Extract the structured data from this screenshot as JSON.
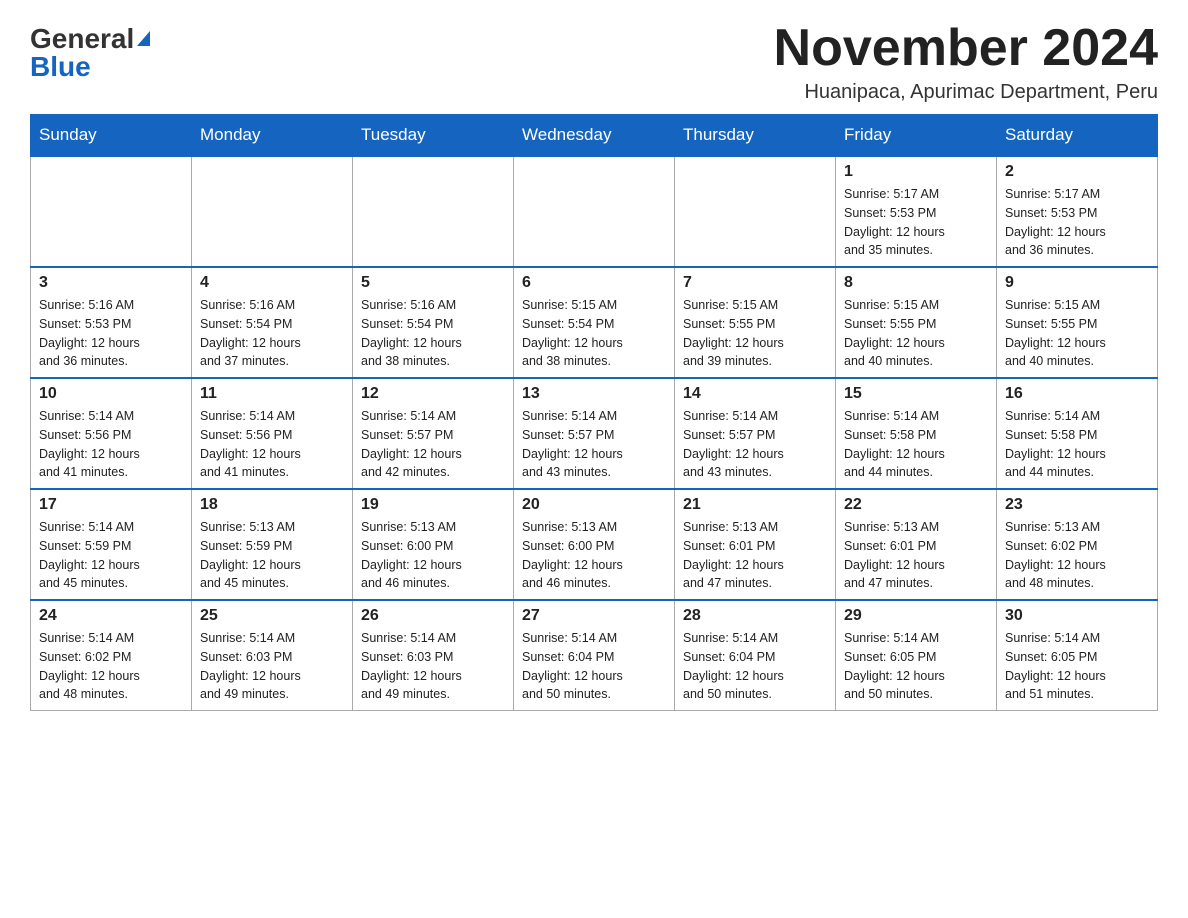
{
  "logo": {
    "general": "General",
    "blue": "Blue"
  },
  "title": {
    "month_year": "November 2024",
    "location": "Huanipaca, Apurimac Department, Peru"
  },
  "days_of_week": [
    "Sunday",
    "Monday",
    "Tuesday",
    "Wednesday",
    "Thursday",
    "Friday",
    "Saturday"
  ],
  "weeks": [
    [
      {
        "day": "",
        "info": ""
      },
      {
        "day": "",
        "info": ""
      },
      {
        "day": "",
        "info": ""
      },
      {
        "day": "",
        "info": ""
      },
      {
        "day": "",
        "info": ""
      },
      {
        "day": "1",
        "info": "Sunrise: 5:17 AM\nSunset: 5:53 PM\nDaylight: 12 hours\nand 35 minutes."
      },
      {
        "day": "2",
        "info": "Sunrise: 5:17 AM\nSunset: 5:53 PM\nDaylight: 12 hours\nand 36 minutes."
      }
    ],
    [
      {
        "day": "3",
        "info": "Sunrise: 5:16 AM\nSunset: 5:53 PM\nDaylight: 12 hours\nand 36 minutes."
      },
      {
        "day": "4",
        "info": "Sunrise: 5:16 AM\nSunset: 5:54 PM\nDaylight: 12 hours\nand 37 minutes."
      },
      {
        "day": "5",
        "info": "Sunrise: 5:16 AM\nSunset: 5:54 PM\nDaylight: 12 hours\nand 38 minutes."
      },
      {
        "day": "6",
        "info": "Sunrise: 5:15 AM\nSunset: 5:54 PM\nDaylight: 12 hours\nand 38 minutes."
      },
      {
        "day": "7",
        "info": "Sunrise: 5:15 AM\nSunset: 5:55 PM\nDaylight: 12 hours\nand 39 minutes."
      },
      {
        "day": "8",
        "info": "Sunrise: 5:15 AM\nSunset: 5:55 PM\nDaylight: 12 hours\nand 40 minutes."
      },
      {
        "day": "9",
        "info": "Sunrise: 5:15 AM\nSunset: 5:55 PM\nDaylight: 12 hours\nand 40 minutes."
      }
    ],
    [
      {
        "day": "10",
        "info": "Sunrise: 5:14 AM\nSunset: 5:56 PM\nDaylight: 12 hours\nand 41 minutes."
      },
      {
        "day": "11",
        "info": "Sunrise: 5:14 AM\nSunset: 5:56 PM\nDaylight: 12 hours\nand 41 minutes."
      },
      {
        "day": "12",
        "info": "Sunrise: 5:14 AM\nSunset: 5:57 PM\nDaylight: 12 hours\nand 42 minutes."
      },
      {
        "day": "13",
        "info": "Sunrise: 5:14 AM\nSunset: 5:57 PM\nDaylight: 12 hours\nand 43 minutes."
      },
      {
        "day": "14",
        "info": "Sunrise: 5:14 AM\nSunset: 5:57 PM\nDaylight: 12 hours\nand 43 minutes."
      },
      {
        "day": "15",
        "info": "Sunrise: 5:14 AM\nSunset: 5:58 PM\nDaylight: 12 hours\nand 44 minutes."
      },
      {
        "day": "16",
        "info": "Sunrise: 5:14 AM\nSunset: 5:58 PM\nDaylight: 12 hours\nand 44 minutes."
      }
    ],
    [
      {
        "day": "17",
        "info": "Sunrise: 5:14 AM\nSunset: 5:59 PM\nDaylight: 12 hours\nand 45 minutes."
      },
      {
        "day": "18",
        "info": "Sunrise: 5:13 AM\nSunset: 5:59 PM\nDaylight: 12 hours\nand 45 minutes."
      },
      {
        "day": "19",
        "info": "Sunrise: 5:13 AM\nSunset: 6:00 PM\nDaylight: 12 hours\nand 46 minutes."
      },
      {
        "day": "20",
        "info": "Sunrise: 5:13 AM\nSunset: 6:00 PM\nDaylight: 12 hours\nand 46 minutes."
      },
      {
        "day": "21",
        "info": "Sunrise: 5:13 AM\nSunset: 6:01 PM\nDaylight: 12 hours\nand 47 minutes."
      },
      {
        "day": "22",
        "info": "Sunrise: 5:13 AM\nSunset: 6:01 PM\nDaylight: 12 hours\nand 47 minutes."
      },
      {
        "day": "23",
        "info": "Sunrise: 5:13 AM\nSunset: 6:02 PM\nDaylight: 12 hours\nand 48 minutes."
      }
    ],
    [
      {
        "day": "24",
        "info": "Sunrise: 5:14 AM\nSunset: 6:02 PM\nDaylight: 12 hours\nand 48 minutes."
      },
      {
        "day": "25",
        "info": "Sunrise: 5:14 AM\nSunset: 6:03 PM\nDaylight: 12 hours\nand 49 minutes."
      },
      {
        "day": "26",
        "info": "Sunrise: 5:14 AM\nSunset: 6:03 PM\nDaylight: 12 hours\nand 49 minutes."
      },
      {
        "day": "27",
        "info": "Sunrise: 5:14 AM\nSunset: 6:04 PM\nDaylight: 12 hours\nand 50 minutes."
      },
      {
        "day": "28",
        "info": "Sunrise: 5:14 AM\nSunset: 6:04 PM\nDaylight: 12 hours\nand 50 minutes."
      },
      {
        "day": "29",
        "info": "Sunrise: 5:14 AM\nSunset: 6:05 PM\nDaylight: 12 hours\nand 50 minutes."
      },
      {
        "day": "30",
        "info": "Sunrise: 5:14 AM\nSunset: 6:05 PM\nDaylight: 12 hours\nand 51 minutes."
      }
    ]
  ]
}
